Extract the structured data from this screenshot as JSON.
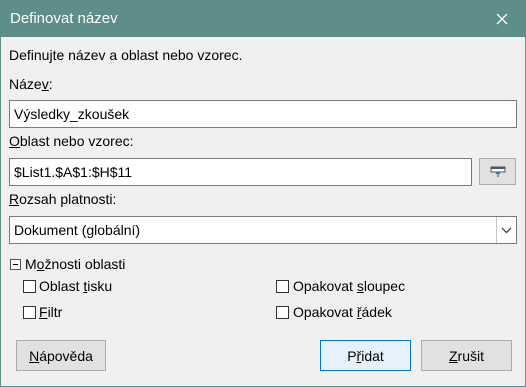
{
  "window": {
    "title": "Definovat název"
  },
  "intro": "Definujte název a oblast nebo vzorec.",
  "name_field": {
    "label_pre": "Náze",
    "label_key": "v",
    "label_post": ":",
    "value": "Výsledky_zkoušek"
  },
  "range_field": {
    "label_pre": "",
    "label_key": "O",
    "label_post": "blast nebo vzorec:",
    "value": "$List1.$A$1:$H$11"
  },
  "scope_field": {
    "label_pre": "",
    "label_key": "R",
    "label_post": "ozsah platnosti:",
    "value": "Dokument (globální)"
  },
  "options": {
    "header_pre": "M",
    "header_key": "o",
    "header_post": "žnosti oblasti",
    "print_range": {
      "pre": "Oblast ",
      "key": "t",
      "post": "isku",
      "checked": false
    },
    "filter": {
      "pre": "",
      "key": "F",
      "post": "iltr",
      "checked": false
    },
    "repeat_column": {
      "pre": "Opakovat ",
      "key": "s",
      "post": "loupec",
      "checked": false
    },
    "repeat_row": {
      "pre": "Opakovat ",
      "key": "ř",
      "post": "ádek",
      "checked": false
    }
  },
  "buttons": {
    "help": {
      "pre": "",
      "key": "N",
      "post": "ápověda"
    },
    "add": {
      "pre": "P",
      "key": "ř",
      "post": "idat"
    },
    "cancel": {
      "pre": "",
      "key": "Z",
      "post": "rušit"
    }
  },
  "colors": {
    "titlebar": "#5e8e89",
    "default_button_border": "#0078d7"
  }
}
